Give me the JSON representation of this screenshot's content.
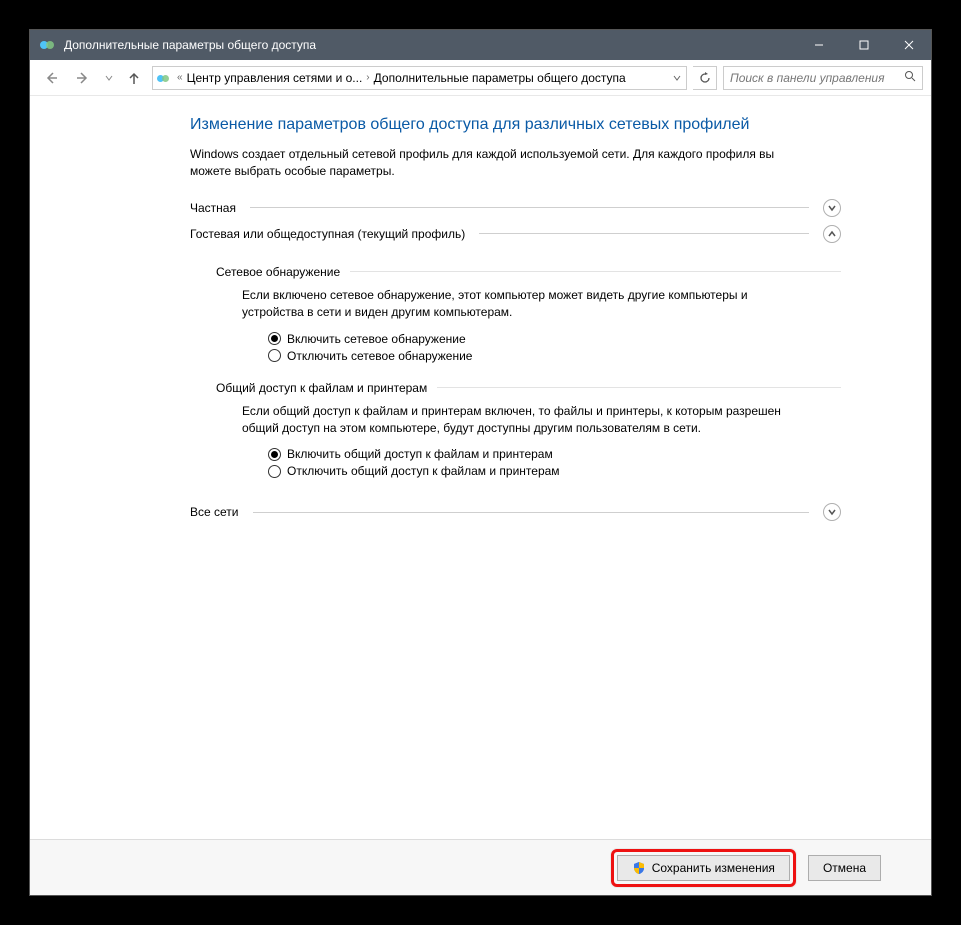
{
  "window": {
    "title": "Дополнительные параметры общего доступа"
  },
  "breadcrumb": {
    "prefix": "«",
    "item1": "Центр управления сетями и о...",
    "item2": "Дополнительные параметры общего доступа"
  },
  "search": {
    "placeholder": "Поиск в панели управления"
  },
  "page": {
    "heading": "Изменение параметров общего доступа для различных сетевых профилей",
    "description": "Windows создает отдельный сетевой профиль для каждой используемой сети. Для каждого профиля вы можете выбрать особые параметры."
  },
  "profiles": {
    "private_label": "Частная",
    "guest_label": "Гостевая или общедоступная (текущий профиль)",
    "allnets_label": "Все сети"
  },
  "network_discovery": {
    "title": "Сетевое обнаружение",
    "description": "Если включено сетевое обнаружение, этот компьютер может видеть другие компьютеры и устройства в сети и виден другим компьютерам.",
    "opt_on": "Включить сетевое обнаружение",
    "opt_off": "Отключить сетевое обнаружение"
  },
  "file_sharing": {
    "title": "Общий доступ к файлам и принтерам",
    "description": "Если общий доступ к файлам и принтерам включен, то файлы и принтеры, к которым разрешен общий доступ на этом компьютере, будут доступны другим пользователям в сети.",
    "opt_on": "Включить общий доступ к файлам и принтерам",
    "opt_off": "Отключить общий доступ к файлам и принтерам"
  },
  "footer": {
    "save": "Сохранить изменения",
    "cancel": "Отмена"
  }
}
